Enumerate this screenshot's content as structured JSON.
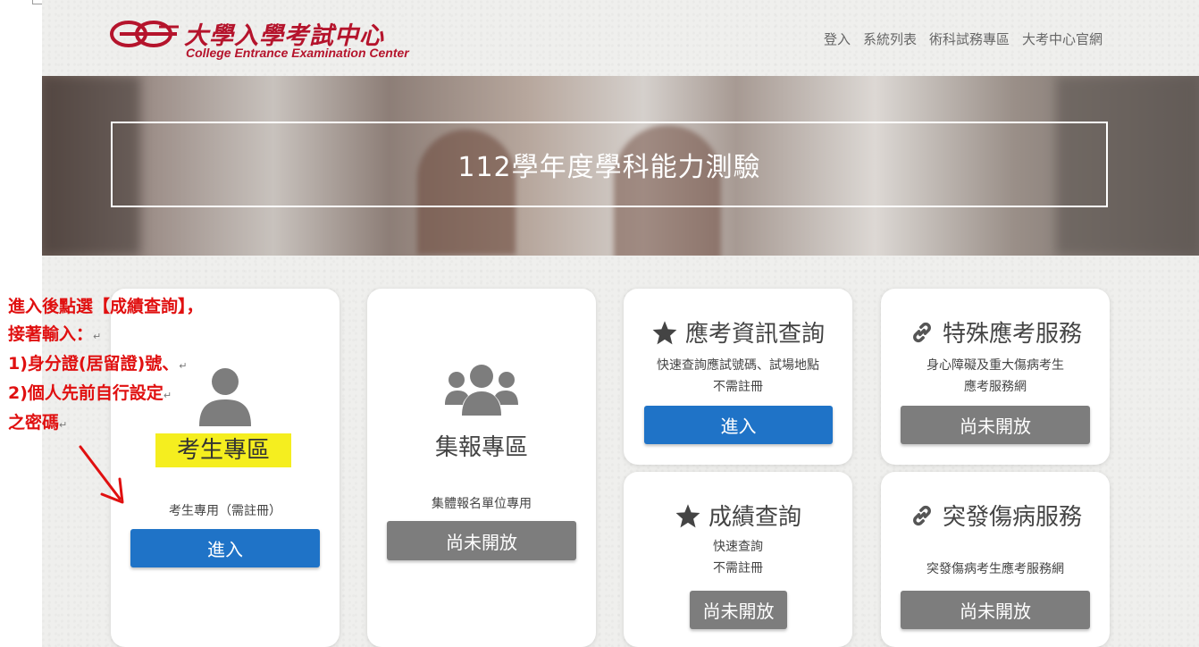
{
  "header": {
    "logo_cn": "大學入學考試中心",
    "logo_en": "College Entrance Examination Center",
    "nav": [
      "登入",
      "系統列表",
      "術科試務專區",
      "大考中心官網"
    ]
  },
  "banner": {
    "title": "112學年度學科能力測驗"
  },
  "cards": {
    "student": {
      "title": "考生專區",
      "desc": "考生專用（需註冊）",
      "button": "進入",
      "icon": "user-icon"
    },
    "group": {
      "title": "集報專區",
      "desc": "集體報名單位專用",
      "button": "尚未開放",
      "icon": "users-icon"
    },
    "exam_info": {
      "title": "應考資訊查詢",
      "lines": [
        "快速查詢應試號碼、試場地點",
        "不需註冊"
      ],
      "button": "進入",
      "icon": "star-icon"
    },
    "special": {
      "title": "特殊應考服務",
      "lines": [
        "身心障礙及重大傷病考生",
        "應考服務網"
      ],
      "button": "尚未開放",
      "icon": "link-icon"
    },
    "score": {
      "title": "成績查詢",
      "lines": [
        "快速查詢",
        "不需註冊"
      ],
      "button": "尚未開放",
      "icon": "star-icon"
    },
    "sudden": {
      "title": "突發傷病服務",
      "lines": [
        "突發傷病考生應考服務網"
      ],
      "button": "尚未開放",
      "icon": "link-icon"
    }
  },
  "annotation": {
    "lines": [
      "進入後點選【成績查詢】，",
      "接著輸入：",
      "1)身分證(居留證)號、",
      "2)個人先前自行設定",
      "之密碼"
    ],
    "color": "#e01010"
  },
  "colors": {
    "brand": "#b5142c",
    "primary": "#1f73c7",
    "disabled": "#7d7d7d",
    "highlight": "#f5ee1f"
  }
}
